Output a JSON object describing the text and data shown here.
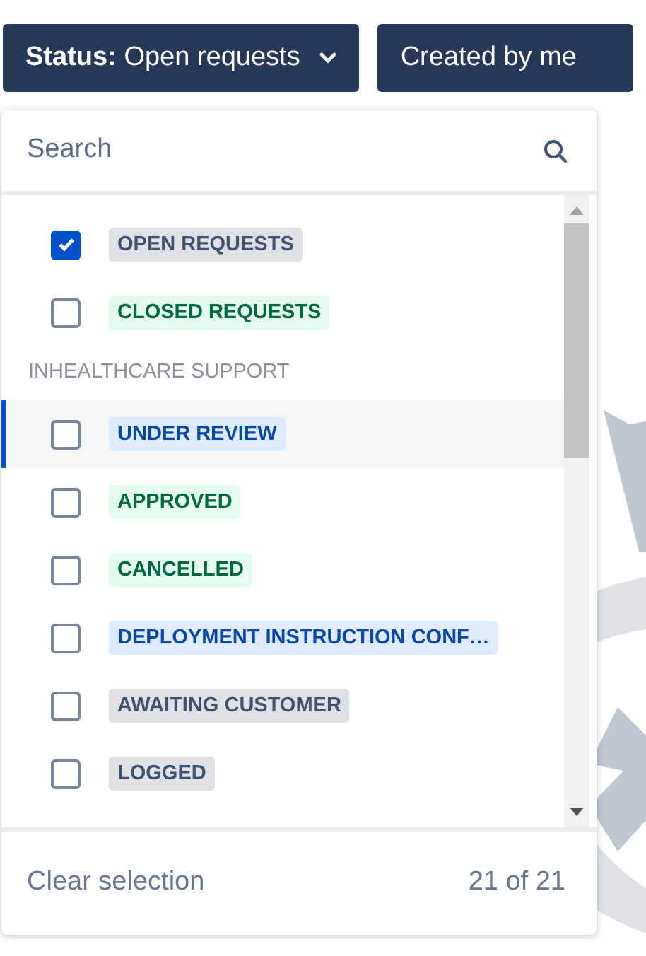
{
  "filters": [
    {
      "label_bold": "Status:",
      "label": "Open requests",
      "has_caret": true
    },
    {
      "label": "Created by me",
      "has_caret": false
    }
  ],
  "dropdown": {
    "search": {
      "placeholder": "Search"
    },
    "groups": [
      {
        "items": [
          {
            "label": "OPEN REQUESTS",
            "checked": true,
            "focused": false,
            "color": "#42526e"
          },
          {
            "label": "CLOSED REQUESTS",
            "checked": false,
            "focused": false,
            "color": "#006644"
          }
        ]
      },
      {
        "heading": "INHEALTHCARE SUPPORT",
        "items": [
          {
            "label": "UNDER REVIEW",
            "checked": false,
            "focused": true,
            "color": "#0747a6"
          },
          {
            "label": "APPROVED",
            "checked": false,
            "focused": false,
            "color": "#006644"
          },
          {
            "label": "CANCELLED",
            "checked": false,
            "focused": false,
            "color": "#006644"
          },
          {
            "label": "DEPLOYMENT INSTRUCTION CONF…",
            "checked": false,
            "focused": false,
            "color": "#0747a6"
          },
          {
            "label": "AWAITING CUSTOMER",
            "checked": false,
            "focused": false,
            "color": "#42526e"
          },
          {
            "label": "LOGGED",
            "checked": false,
            "focused": false,
            "color": "#42526e"
          }
        ]
      }
    ],
    "footer": {
      "clear": "Clear selection",
      "count": "21 of 21"
    }
  }
}
